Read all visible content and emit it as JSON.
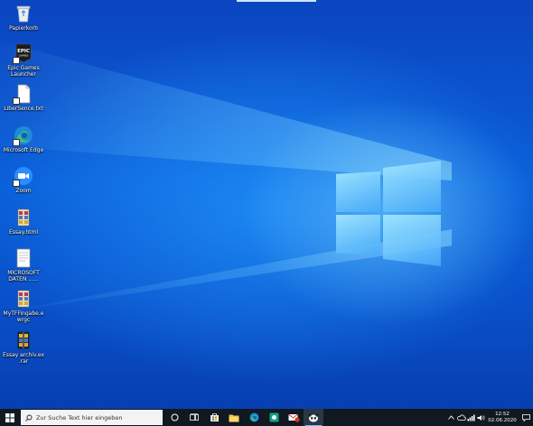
{
  "desktop": {
    "icons": [
      {
        "label": "Papierkorb",
        "icon": "recycle-bin-icon"
      },
      {
        "label": "Epic Games Launcher",
        "icon": "epic-games-icon"
      },
      {
        "label": "LiberSence.txt",
        "icon": "text-file-icon"
      },
      {
        "label": "Microsoft Edge",
        "icon": "edge-icon"
      },
      {
        "label": "Zoom",
        "icon": "zoom-icon"
      },
      {
        "label": "Essay.html",
        "icon": "winrar-archive-icon"
      },
      {
        "label": "MICROSOFT DATEN ......",
        "icon": "document-icon"
      },
      {
        "label": "MyTFFingabe.ewrgc",
        "icon": "winrar-archive-icon"
      },
      {
        "label": "Essay archiv.ex .rar",
        "icon": "winrar-archive-icon"
      }
    ]
  },
  "taskbar": {
    "search_placeholder": "Zur Suche Text hier eingeben",
    "pinned": [
      {
        "name": "cortana-icon"
      },
      {
        "name": "task-view-icon"
      },
      {
        "name": "store-icon"
      },
      {
        "name": "file-explorer-icon"
      },
      {
        "name": "edge-icon"
      },
      {
        "name": "green-app-icon"
      },
      {
        "name": "mail-icon",
        "badge": "6"
      },
      {
        "name": "panda-app-icon",
        "active": true
      }
    ],
    "clock": {
      "time": "12:52",
      "date": "02.06.2020"
    }
  },
  "colors": {
    "accent": "#0a5fd9",
    "taskbar": "#101820"
  }
}
